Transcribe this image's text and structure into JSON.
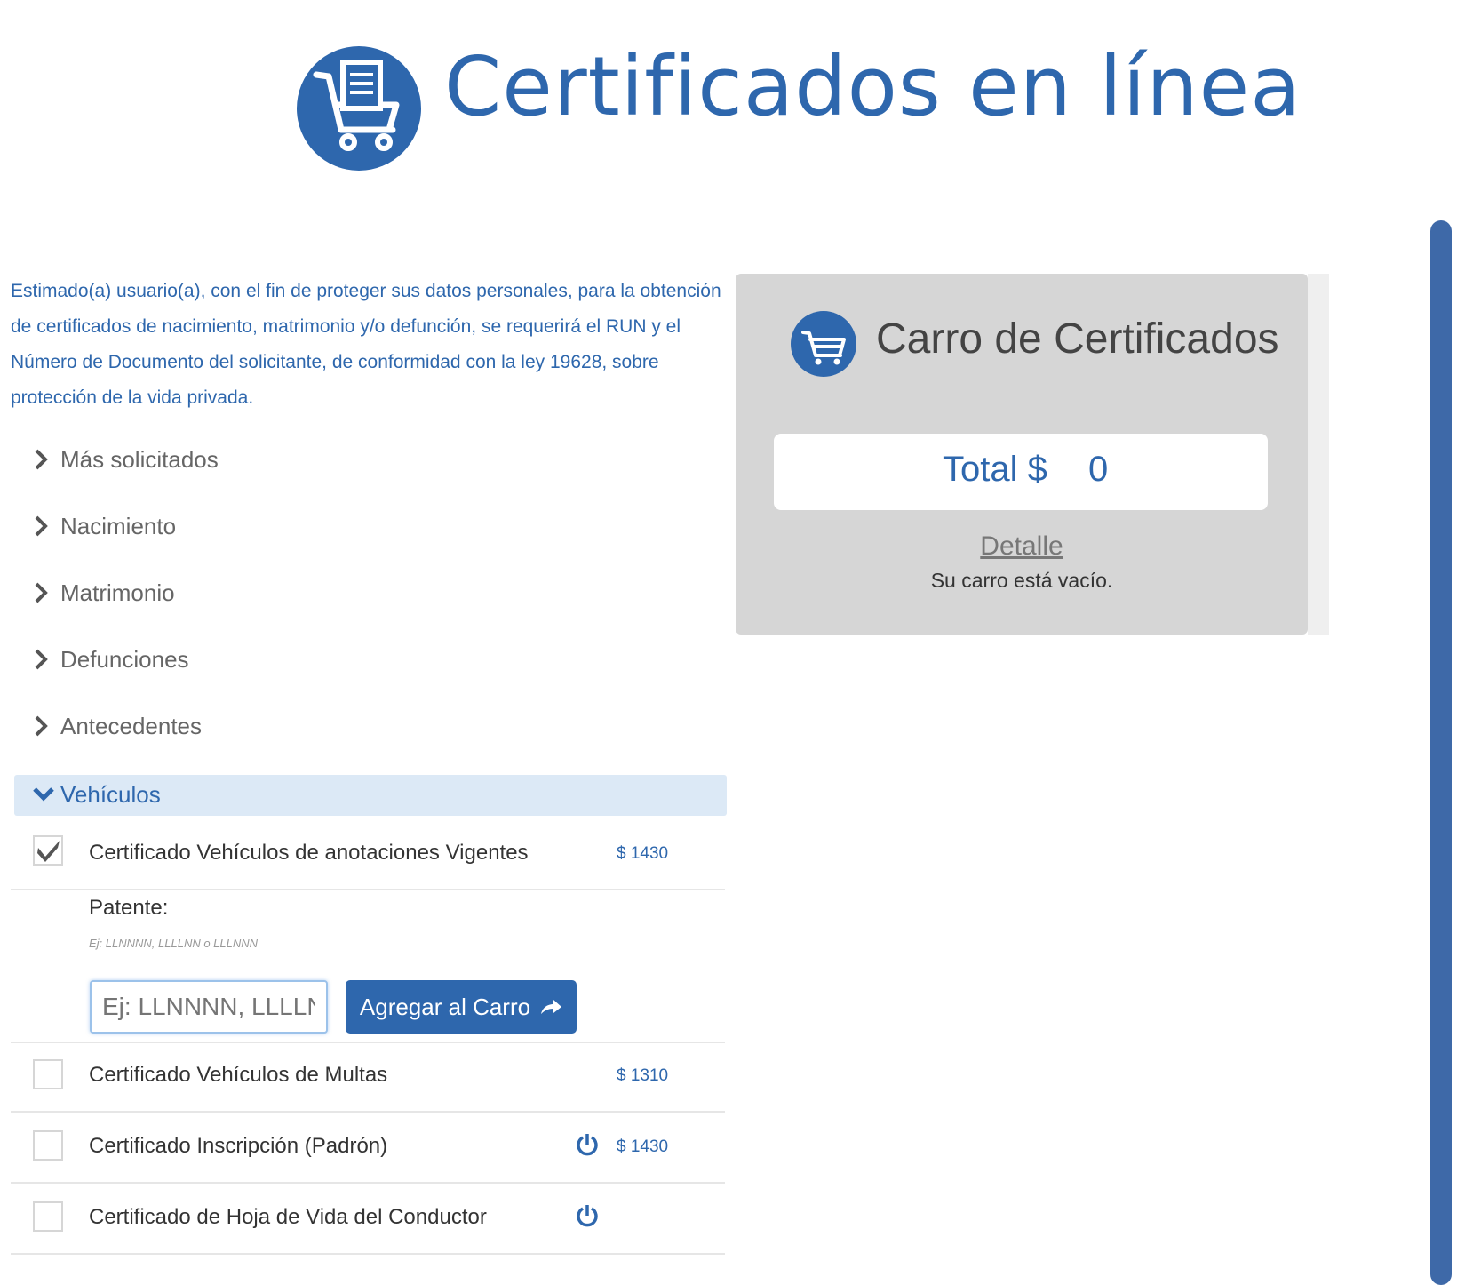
{
  "header": {
    "title": "Certificados en línea",
    "logo_icon": "cart-document-icon"
  },
  "intro": {
    "text": "Estimado(a) usuario(a), con el fin de proteger sus datos personales, para la obtención de certificados de nacimiento, matrimonio y/o defunción, se requerirá el RUN y el Número de Documento del solicitante, de conformidad con la ley 19628, sobre protección de la vida privada."
  },
  "categories": [
    {
      "label": "Más solicitados"
    },
    {
      "label": "Nacimiento"
    },
    {
      "label": "Matrimonio"
    },
    {
      "label": "Defunciones"
    },
    {
      "label": "Antecedentes"
    }
  ],
  "vehiculos": {
    "label": "Vehículos",
    "items": [
      {
        "title": "Certificado Vehículos de anotaciones Vigentes",
        "price": "$ 1430",
        "checked": true
      },
      {
        "title": "Certificado Vehículos de Multas",
        "price": "$ 1310",
        "checked": false
      },
      {
        "title": "Certificado Inscripción (Padrón)",
        "price": "$ 1430",
        "checked": false,
        "power_icon": true
      },
      {
        "title": "Certificado de Hoja de Vida del Conductor",
        "price": "",
        "checked": false,
        "power_icon": true
      }
    ],
    "patente": {
      "label": "Patente:",
      "hint": "Ej: LLNNNN, LLLLNN o LLLNNN",
      "placeholder": "Ej: LLNNNN, LLLLNN o LLLNNN",
      "value": "",
      "button_label": "Agregar al Carro"
    }
  },
  "cart": {
    "title": "Carro de Certificados",
    "total_label": "Total $",
    "total_value": "0",
    "detalle_label": "Detalle",
    "empty_message": "Su carro está vacío."
  },
  "colors": {
    "brand": "#2e67ad",
    "cart_bg": "#d6d6d6",
    "accordion_active": "#dce9f6"
  }
}
